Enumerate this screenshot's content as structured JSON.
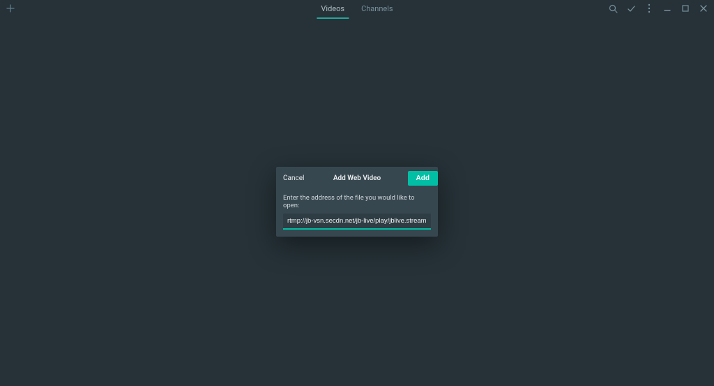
{
  "tabs": {
    "videos": "Videos",
    "channels": "Channels"
  },
  "modal": {
    "cancel": "Cancel",
    "title": "Add Web Video",
    "add": "Add",
    "label": "Enter the address of the file you would like to open:",
    "url": "rtmp://jb-vsn.secdn.net/jb-live/play/jblive.stream"
  }
}
